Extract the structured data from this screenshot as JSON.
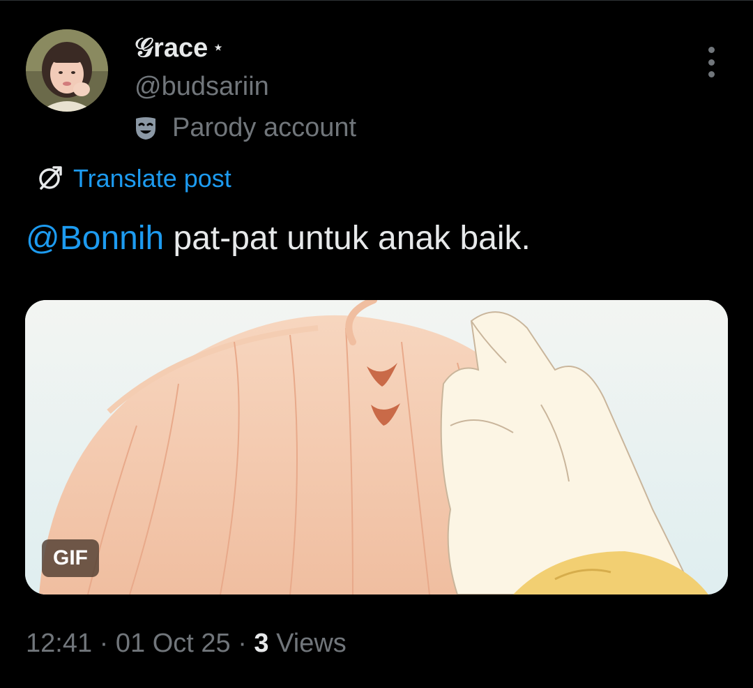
{
  "author": {
    "display_name": "𝒢race",
    "name_badge": "⋆",
    "handle": "@budsariin",
    "account_label": "Parody account",
    "avatar_icon": "avatar-photo"
  },
  "translate": {
    "label": "Translate post",
    "icon": "globe-icon"
  },
  "post": {
    "mention": "@Bonnih",
    "text": " pat-pat untuk anak baik."
  },
  "media": {
    "badge": "GIF"
  },
  "meta": {
    "time": "12:41",
    "sep1": " · ",
    "date": "01 Oct 25",
    "sep2": " · ",
    "views_count": "3",
    "views_label": " Views"
  },
  "colors": {
    "background": "#000000",
    "primary_text": "#e7e9ea",
    "secondary_text": "#71767b",
    "link": "#1d9bf0"
  }
}
